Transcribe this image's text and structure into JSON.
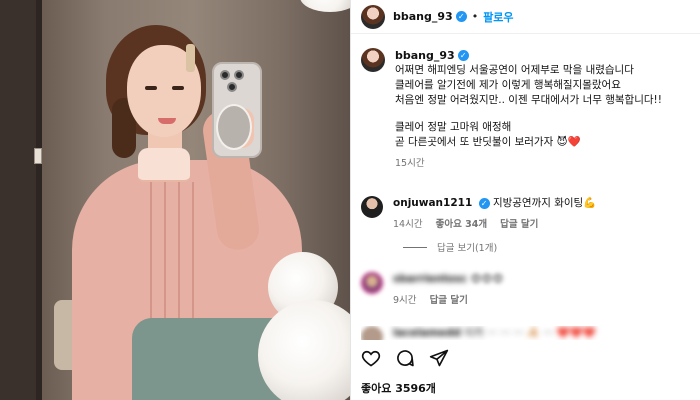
{
  "post": {
    "username": "bbang_93",
    "follow_label": "팔로우",
    "caption_lines": [
      "어쩌면 해피엔딩 서울공연이 어제부로 막을 내렸습니다",
      "클레어를 알기전에 제가 이렇게 행복해질지몰랐어요",
      "처음엔 정말 어려웠지만.. 이젠 무대에서가 너무 행복합니다!!",
      "",
      "클레어 정말 고마워 애정해",
      "곧 다른곳에서 또 반딧불이 보러가자 😈❤️"
    ],
    "caption_time": "15시간",
    "likes": "좋아요 3596개"
  },
  "comments": [
    {
      "username": "onjuwan1211",
      "text": "지방공연까지 화이팅💪",
      "time": "14시간",
      "likes": "좋아요 34개",
      "reply_label": "답글 달기",
      "view_replies": "답글 보기(1개)"
    },
    {
      "username": "sbarrientosc",
      "text": "😍😍😍",
      "time": "9시간",
      "reply_label": "답글 달기"
    },
    {
      "username": "lacelamedd",
      "text": "이카 ··· ··· ··· 🦂 ··· ❤️❤️❤️"
    }
  ],
  "icons": [
    "heart-icon",
    "comment-icon",
    "share-icon",
    "verified-badge-icon"
  ],
  "colors": {
    "accent": "#0095f6",
    "verified": "#2196f3",
    "muted": "#737373"
  }
}
